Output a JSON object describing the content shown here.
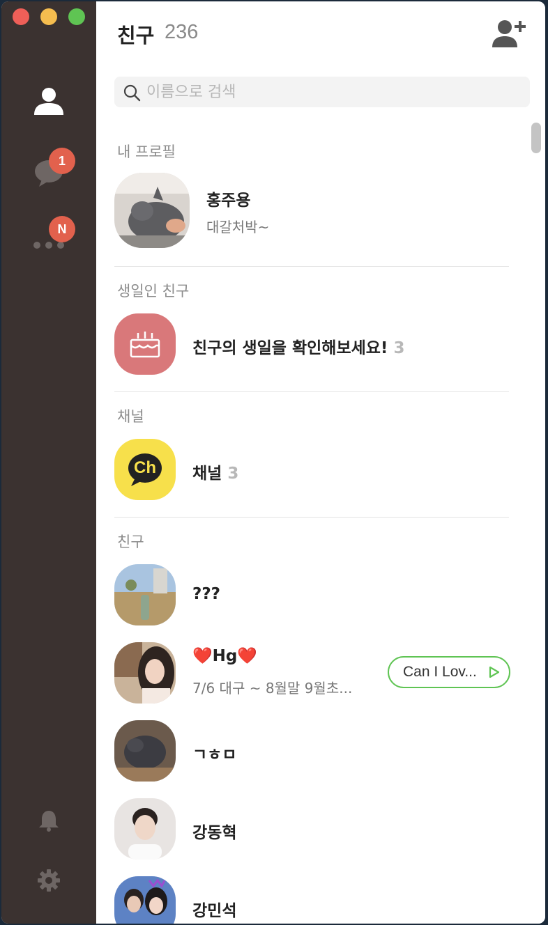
{
  "header": {
    "title": "친구",
    "count": "236"
  },
  "search": {
    "placeholder": "이름으로 검색"
  },
  "sidebar": {
    "chat_badge": "1",
    "more_badge": "N"
  },
  "sections": {
    "my_profile": "내 프로필",
    "birthday": "생일인 친구",
    "channel": "채널",
    "friends": "친구"
  },
  "my_profile": {
    "name": "홍주용",
    "status": "대갈처박~"
  },
  "birthday": {
    "text": "친구의 생일을 확인해보세요!",
    "count": "3"
  },
  "channel": {
    "name": "채널",
    "count": "3",
    "icon_text": "Ch"
  },
  "friends": [
    {
      "name": "???",
      "status": ""
    },
    {
      "name": "❤️Hg❤️",
      "status": "7/6 대구 ~ 8월말 9월초...",
      "music": "Can I Lov..."
    },
    {
      "name": "ㄱㅎㅁ",
      "status": ""
    },
    {
      "name": "강동혁",
      "status": ""
    },
    {
      "name": "강민석",
      "status": ""
    }
  ],
  "colors": {
    "sidebar": "#3b3230",
    "badge": "#e2614d",
    "birthday_bg": "#d9787a",
    "channel_bg": "#f7e04b",
    "music_border": "#5fc453"
  }
}
